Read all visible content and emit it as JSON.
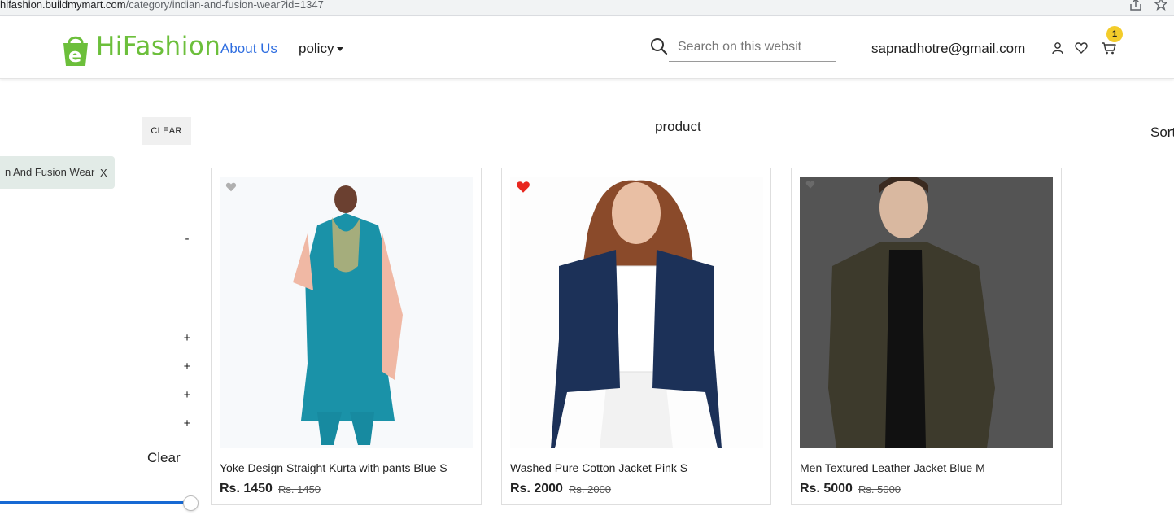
{
  "browser": {
    "url_host": "hifashion.buildmymart.com",
    "url_path": "/category/indian-and-fusion-wear?id=1347"
  },
  "header": {
    "logo_text": "HiFashion",
    "logo_letter": "e",
    "nav": {
      "about": "About Us",
      "policy": "policy"
    },
    "search": {
      "placeholder": "Search on this websit"
    },
    "user_email": "sapnadhotre@gmail.com",
    "cart_count": "1"
  },
  "sidebar": {
    "clear_button": "CLEAR",
    "active_filter": {
      "label": "n And Fusion Wear",
      "remove": "X"
    },
    "toggles": [
      "-",
      "+",
      "+",
      "+",
      "+"
    ],
    "clear_text": "Clear",
    "price_slider_fraction": 1.0
  },
  "main": {
    "title": "product",
    "sort_label": "Sort"
  },
  "products": [
    {
      "name": "Yoke Design Straight Kurta with pants Blue S",
      "price": "Rs. 1450",
      "mrp": "Rs. 1450",
      "wishlisted": false
    },
    {
      "name": "Washed Pure Cotton Jacket Pink S",
      "price": "Rs. 2000",
      "mrp": "Rs. 2000",
      "wishlisted": true
    },
    {
      "name": "Men Textured Leather Jacket Blue M",
      "price": "Rs. 5000",
      "mrp": "Rs. 5000",
      "wishlisted": false
    }
  ],
  "colors": {
    "brand_green": "#6cbf3b",
    "link_blue": "#2f6ee0",
    "badge_yellow": "#f3cc2a",
    "wishlist_red": "#e8271f",
    "slider_blue": "#1769d3"
  }
}
